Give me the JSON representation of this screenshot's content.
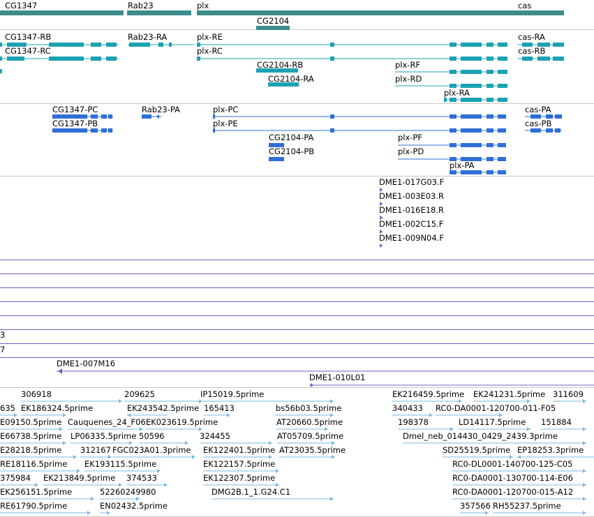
{
  "colors": {
    "gene": "#3c8c8c",
    "transcript": "#1ca2b3",
    "protein": "#2f6fd6",
    "clone": "#7a5cc0",
    "est": "#79b9e0",
    "separator": "#c8c8c8"
  },
  "tracks": {
    "genes": {
      "labels": [
        "CG1347",
        "Rab23",
        "plx",
        "cas",
        "CG2104"
      ]
    },
    "transcripts": {
      "labels": [
        "CG1347-RB",
        "Rab23-RA",
        "plx-RE",
        "cas-RA",
        "CG1347-RC",
        "plx-RC",
        "cas-RB",
        "CG2104-RB",
        "plx-RF",
        "CG2104-RA",
        "plx-RD",
        "plx-RA"
      ]
    },
    "proteins": {
      "labels": [
        "CG1347-PC",
        "Rab23-PA",
        "plx-PC",
        "cas-PA",
        "CG1347-PB",
        "plx-PE",
        "cas-PB",
        "CG2104-PA",
        "plx-PF",
        "CG2104-PB",
        "plx-PD",
        "plx-PA"
      ]
    },
    "clones": {
      "labels": [
        "DME1-017G03.F",
        "DME1-003E03.R",
        "DME1-016E18.R",
        "DME1-002C15.F",
        "DME1-009N04.F"
      ]
    },
    "bacs": {
      "edge_labels": [
        "3",
        "7"
      ],
      "labels": [
        "DME1-007M16",
        "DME1-010L01"
      ]
    },
    "ests": {
      "labels": [
        "306918",
        "209625",
        "IP15019.5prime",
        "EK216459.5prime",
        "EK241231.5prime",
        "311609",
        "635",
        "EK186324.5prime",
        "EK243542.5prime",
        "165413",
        "bs56b03.5prime",
        "340433",
        "RC0-DA0001-120700-011-F05",
        "E09150.5prime",
        "Cauquenes_24_F06",
        "EK023619.5prime",
        "AT20660.5prime",
        "198378",
        "LD14117.5prime",
        "151884",
        "E66738.5prime",
        "LP06335.5prime",
        "50596",
        "324455",
        "AT05709.5prime",
        "Dmel_neb_014430_0429_2439.3prime",
        "E28218.5prime",
        "312167",
        "FGC023A01.3prime",
        "EK122401.5prime",
        "AT23035.5prime",
        "SD25519.5prime",
        "EP18253.3prime",
        "RE18116.5prime",
        "EK193115.5prime",
        "EK122157.5prime",
        "RC0-DL0001-140700-125-C05",
        "375984",
        "EK213849.5prime",
        "374533",
        "EK122307.5prime",
        "RC0-DA0001-130700-114-E06",
        "EK256151.5prime",
        "52260249980",
        "DMG2B.1_1.G24.C1",
        "RC0-DA0001-120700-015-A12",
        "RE61790.5prime",
        "EN02432.5prime",
        "357566",
        "RH55237.5prime"
      ]
    }
  }
}
